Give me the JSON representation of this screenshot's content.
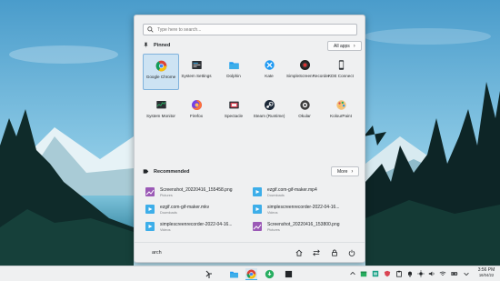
{
  "search": {
    "placeholder": "Type here to search..."
  },
  "pinned": {
    "title": "Pinned",
    "all_apps_label": "All apps",
    "apps": [
      {
        "label": "Google Chrome",
        "icon": "chrome-icon"
      },
      {
        "label": "System Settings",
        "icon": "system-settings-icon"
      },
      {
        "label": "Dolphin",
        "icon": "dolphin-icon"
      },
      {
        "label": "Kate",
        "icon": "kate-icon"
      },
      {
        "label": "SimpleScreenRecorder",
        "icon": "simplescreenrecorder-icon"
      },
      {
        "label": "KDE Connect",
        "icon": "kde-connect-icon"
      },
      {
        "label": "System Monitor",
        "icon": "system-monitor-icon"
      },
      {
        "label": "Firefox",
        "icon": "firefox-icon"
      },
      {
        "label": "Spectacle",
        "icon": "spectacle-icon"
      },
      {
        "label": "Steam (Runtime)",
        "icon": "steam-icon"
      },
      {
        "label": "Okular",
        "icon": "okular-icon"
      },
      {
        "label": "KolourPaint",
        "icon": "kolourpaint-icon"
      }
    ]
  },
  "recommended": {
    "title": "Recommended",
    "more_label": "More",
    "items": [
      {
        "name": "Screenshot_20220416_155458.png",
        "location": "Pictures",
        "icon": "image-file-icon"
      },
      {
        "name": "ezgif.com-gif-maker.mp4",
        "location": "Downloads",
        "icon": "video-file-icon"
      },
      {
        "name": "ezgif.com-gif-maker.mkv",
        "location": "Downloads",
        "icon": "video-file-icon"
      },
      {
        "name": "simplescreenrecorder-2022-04-16...",
        "location": "Videos",
        "icon": "video-file-icon"
      },
      {
        "name": "simplescreenrecorder-2022-04-16...",
        "location": "Videos",
        "icon": "video-file-icon"
      },
      {
        "name": "Screenshot_20220416_153800.png",
        "location": "Pictures",
        "icon": "image-file-icon"
      }
    ]
  },
  "footer": {
    "username": "arch"
  },
  "taskbar": {
    "time": "3:56 PM",
    "date": "16/04/22"
  },
  "colors": {
    "accent": "#3daee9",
    "menu_bg": "#eff0f1",
    "selected_bg": "#cde3f3"
  }
}
